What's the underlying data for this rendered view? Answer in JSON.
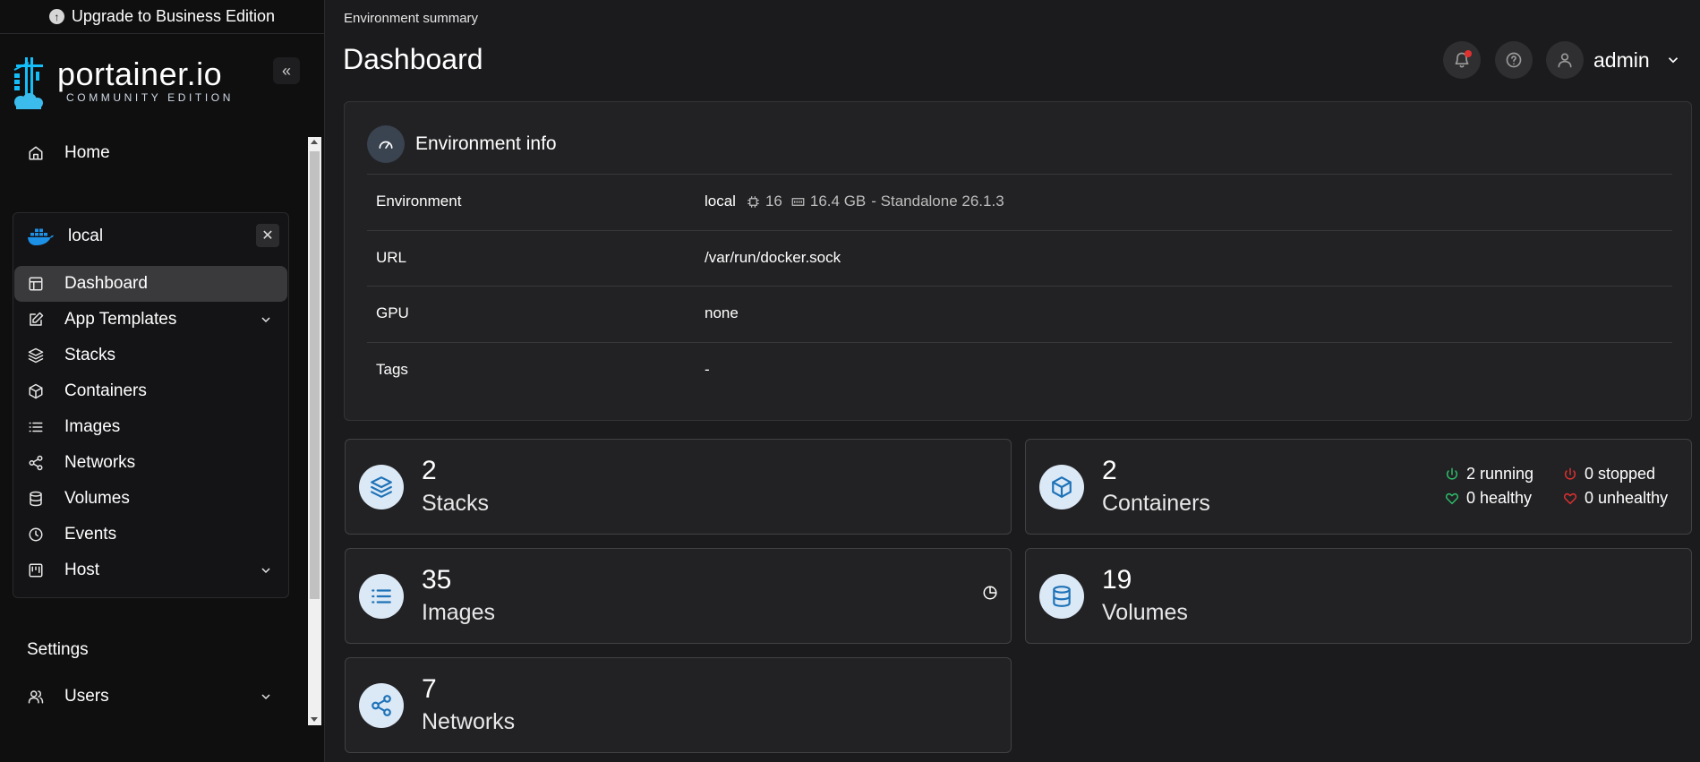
{
  "upgrade_banner": {
    "label": "Upgrade to Business Edition"
  },
  "logo": {
    "name": "portainer.io",
    "edition": "COMMUNITY EDITION"
  },
  "sidebar": {
    "home": "Home",
    "environment": {
      "name": "local"
    },
    "items": [
      {
        "label": "Dashboard",
        "icon": "dashboard-icon"
      },
      {
        "label": "App Templates",
        "icon": "edit-icon"
      },
      {
        "label": "Stacks",
        "icon": "layers-icon"
      },
      {
        "label": "Containers",
        "icon": "box-icon"
      },
      {
        "label": "Images",
        "icon": "list-icon"
      },
      {
        "label": "Networks",
        "icon": "share-icon"
      },
      {
        "label": "Volumes",
        "icon": "database-icon"
      },
      {
        "label": "Events",
        "icon": "clock-icon"
      },
      {
        "label": "Host",
        "icon": "host-icon"
      }
    ],
    "settings_label": "Settings",
    "users_label": "Users"
  },
  "header": {
    "breadcrumb": "Environment summary",
    "title": "Dashboard",
    "user": "admin"
  },
  "environment_info": {
    "title": "Environment info",
    "rows": [
      {
        "key": "Environment",
        "name": "local",
        "cpu": "16",
        "memory": "16.4 GB",
        "detail": "- Standalone 26.1.3"
      },
      {
        "key": "URL",
        "value": "/var/run/docker.sock"
      },
      {
        "key": "GPU",
        "value": "none"
      },
      {
        "key": "Tags",
        "value": "-"
      }
    ]
  },
  "stats": {
    "stacks": {
      "count": "2",
      "label": "Stacks"
    },
    "containers": {
      "count": "2",
      "label": "Containers",
      "running": "2 running",
      "stopped": "0 stopped",
      "healthy": "0 healthy",
      "unhealthy": "0 unhealthy"
    },
    "images": {
      "count": "35",
      "label": "Images"
    },
    "volumes": {
      "count": "19",
      "label": "Volumes"
    },
    "networks": {
      "count": "7",
      "label": "Networks"
    }
  },
  "colors": {
    "accent": "#1d72b8",
    "running": "#2ebd6b",
    "stopped": "#e03030"
  }
}
